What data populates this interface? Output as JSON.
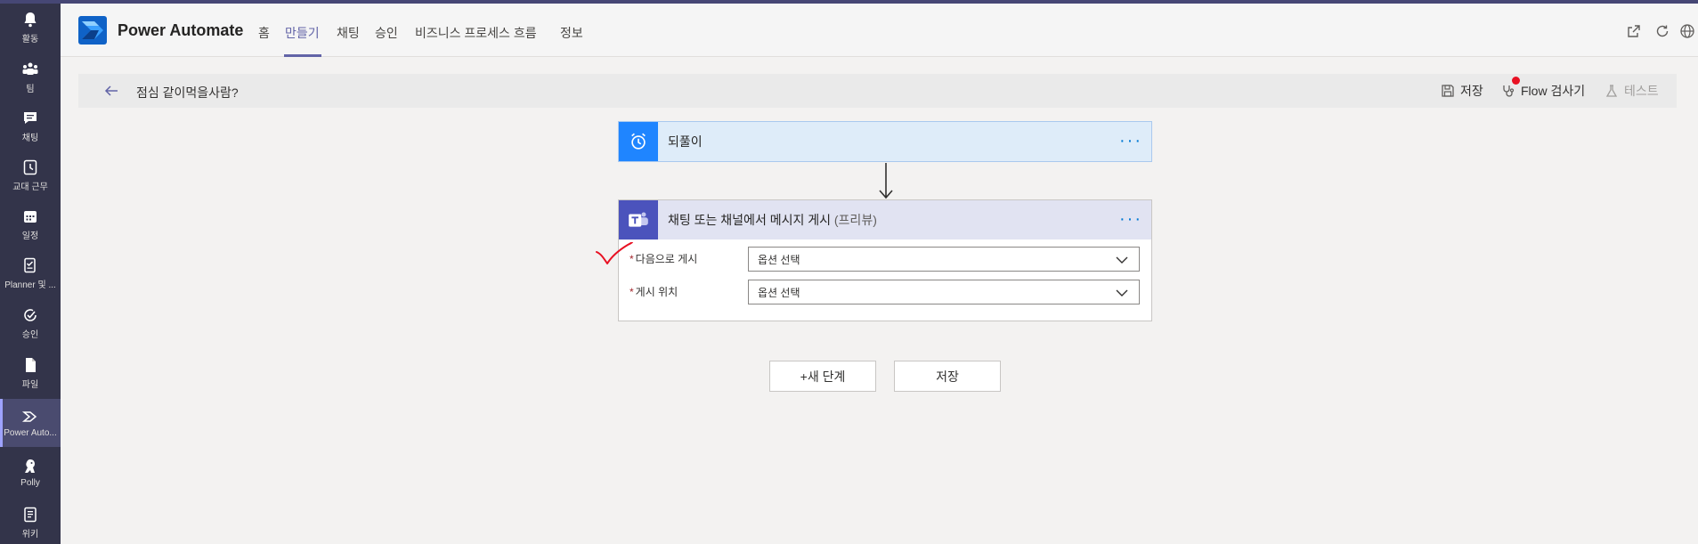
{
  "rail": {
    "items": [
      {
        "label": "활동",
        "icon": "bell-icon"
      },
      {
        "label": "팀",
        "icon": "teams-icon"
      },
      {
        "label": "채팅",
        "icon": "chat-icon"
      },
      {
        "label": "교대 근무",
        "icon": "shifts-icon"
      },
      {
        "label": "일정",
        "icon": "calendar-icon"
      },
      {
        "label": "Planner 및 ...",
        "icon": "planner-icon"
      },
      {
        "label": "승인",
        "icon": "approvals-icon"
      },
      {
        "label": "파일",
        "icon": "files-icon"
      },
      {
        "label": "Power Auto...",
        "icon": "power-automate-icon"
      },
      {
        "label": "Polly",
        "icon": "polly-icon"
      },
      {
        "label": "위키",
        "icon": "wiki-icon"
      }
    ]
  },
  "header": {
    "title": "Power Automate",
    "tabs": [
      {
        "label": "홈"
      },
      {
        "label": "만들기"
      },
      {
        "label": "채팅"
      },
      {
        "label": "승인"
      },
      {
        "label": "비즈니스 프로세스 흐름"
      },
      {
        "label": "정보"
      }
    ],
    "active_tab": "만들기"
  },
  "commandbar": {
    "flow_name": "점심 같이먹을사람?",
    "save_label": "저장",
    "checker_label": "Flow 검사기",
    "test_label": "테스트"
  },
  "trigger": {
    "title": "되풀이",
    "more": "···"
  },
  "action": {
    "title": "채팅 또는 채널에서 메시지 게시",
    "title_suffix": "(프리뷰)",
    "more": "···",
    "fields": [
      {
        "required": "*",
        "label": "다음으로 게시",
        "value": "옵션 선택"
      },
      {
        "required": "*",
        "label": "게시 위치",
        "value": "옵션 선택"
      }
    ]
  },
  "footer": {
    "new_step_label": "+새 단계",
    "save_label": "저장"
  },
  "colors": {
    "rail": "#33344a",
    "accent": "#6264a7",
    "trigger_head": "#deecf9",
    "trigger_icon": "#1f85ff",
    "action_head": "#e1e3f2",
    "action_icon": "#4b53bc",
    "checker_dot": "#e81123",
    "annotation": "#e81123"
  }
}
